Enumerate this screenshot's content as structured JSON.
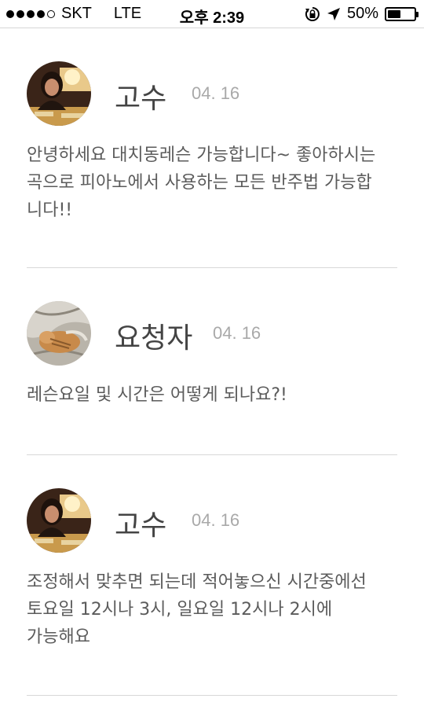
{
  "status_bar": {
    "carrier": "SKT",
    "network": "LTE",
    "time": "오후 2:39",
    "battery": "50%",
    "battery_level": 0.5,
    "icons": [
      "signal-dots-icon",
      "rotation-lock-icon",
      "location-arrow-icon",
      "battery-icon"
    ]
  },
  "messages": [
    {
      "sender": "고수",
      "date": "04. 16",
      "text": "안녕하세요 대치동레슨 가능합니다~ 좋아하시는\n곡으로 피아노에서 사용하는 모든 반주법 가능합\n니다!!",
      "avatar": "gosu-avatar"
    },
    {
      "sender": "요청자",
      "date": "04. 16",
      "text": "레슨요일 및 시간은 어떻게 되나요?!",
      "avatar": "cat-avatar"
    },
    {
      "sender": "고수",
      "date": "04. 16",
      "text": "조정해서 맞추면 되는데 적어놓으신 시간중에선\n토요일 12시나 3시, 일요일 12시나 2시에\n가능해요",
      "avatar": "gosu-avatar"
    }
  ]
}
